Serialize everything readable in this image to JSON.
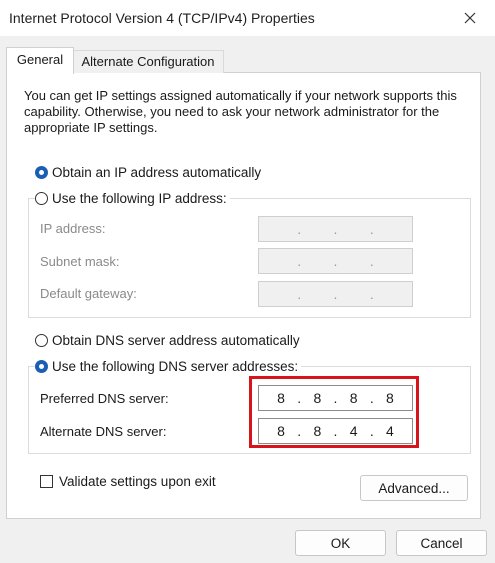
{
  "window": {
    "title": "Internet Protocol Version 4 (TCP/IPv4) Properties",
    "close_icon": "close-icon"
  },
  "tabs": [
    {
      "label": "General",
      "selected": true
    },
    {
      "label": "Alternate Configuration",
      "selected": false
    }
  ],
  "description": "You can get IP settings assigned automatically if your network supports this capability. Otherwise, you need to ask your network administrator for the appropriate IP settings.",
  "ip_settings": {
    "auto_label": "Obtain an IP address automatically",
    "manual_label": "Use the following IP address:",
    "auto_selected": true,
    "fields": [
      {
        "label": "IP address:",
        "value": [
          "",
          "",
          "",
          ""
        ]
      },
      {
        "label": "Subnet mask:",
        "value": [
          "",
          "",
          "",
          ""
        ]
      },
      {
        "label": "Default gateway:",
        "value": [
          "",
          "",
          "",
          ""
        ]
      }
    ]
  },
  "dns_settings": {
    "auto_label": "Obtain DNS server address automatically",
    "manual_label": "Use the following DNS server addresses:",
    "manual_selected": true,
    "preferred": {
      "label": "Preferred DNS server:",
      "octets": [
        "8",
        "8",
        "8",
        "8"
      ]
    },
    "alternate": {
      "label": "Alternate DNS server:",
      "octets": [
        "8",
        "8",
        "4",
        "4"
      ]
    }
  },
  "highlight_color": "#d7141c",
  "radio_selected_color": "#1a5fb4",
  "validate_label": "Validate settings upon exit",
  "validate_checked": false,
  "buttons": {
    "advanced": "Advanced...",
    "ok": "OK",
    "cancel": "Cancel"
  }
}
